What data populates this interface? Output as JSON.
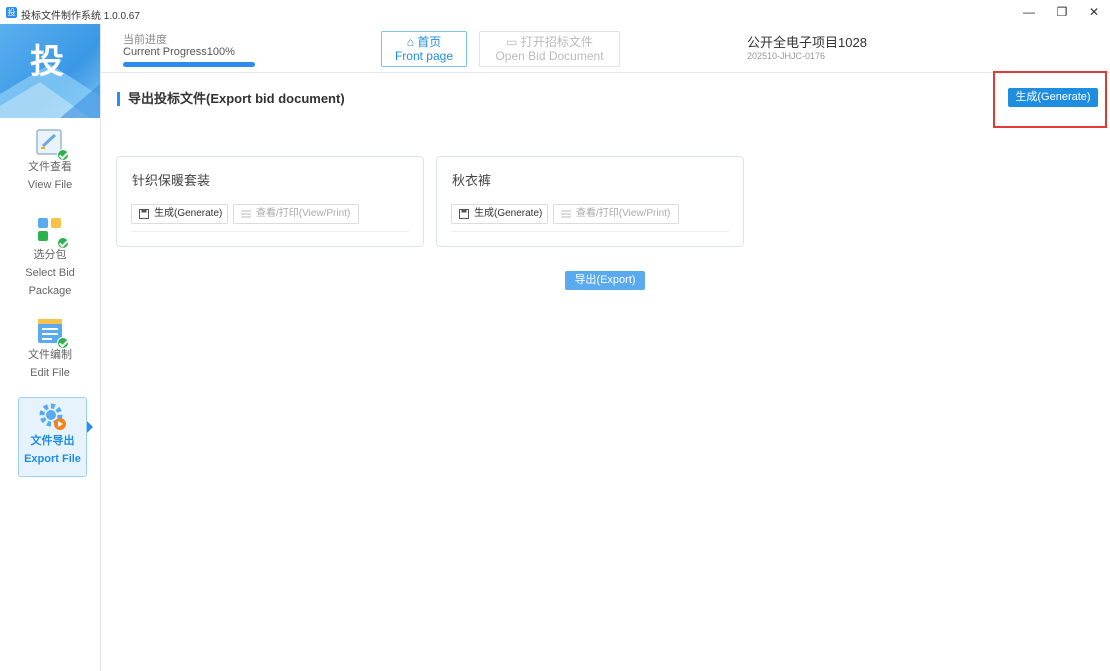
{
  "app": {
    "icon_char": "投",
    "title": "投标文件制作系统 1.0.0.67"
  },
  "window_controls": {
    "minimize": "—",
    "maximize": "❐",
    "close": "✕"
  },
  "logo": {
    "char": "投"
  },
  "sidebar": {
    "items": [
      {
        "label_cn": "文件查看",
        "label_en": "View File",
        "icon": "document-edit-icon",
        "completed": true
      },
      {
        "label_cn": "选分包",
        "label_en_line1": "Select Bid",
        "label_en_line2": "Package",
        "icon": "grid-blocks-icon",
        "completed": true
      },
      {
        "label_cn": "文件编制",
        "label_en": "Edit File",
        "icon": "notepad-icon",
        "completed": true
      },
      {
        "label_cn": "文件导出",
        "label_en": "Export File",
        "icon": "gear-export-icon",
        "active": true
      }
    ]
  },
  "header": {
    "progress_label": "当前进度",
    "progress_text": "Current Progress100%",
    "progress_value": 1.0,
    "home_cn": "首页",
    "home_en": "Front page",
    "open_cn": "打开招标文件",
    "open_en": "Open Bid Document",
    "project_name": "公开全电子项目1028",
    "project_code": "202510-JHJC-0176"
  },
  "main": {
    "section_title": "导出投标文件(Export bid document)",
    "generate_button": "生成(Generate)",
    "cards": [
      {
        "title": "针织保暖套装",
        "generate": "生成(Generate)",
        "view": "查看/打印(View/Print)"
      },
      {
        "title": "秋衣裤",
        "generate": "生成(Generate)",
        "view": "查看/打印(View/Print)"
      }
    ],
    "export_button": "导出(Export)"
  },
  "colors": {
    "accent": "#2d8cf0",
    "highlight": "#e53935",
    "check": "#2bb24c"
  }
}
